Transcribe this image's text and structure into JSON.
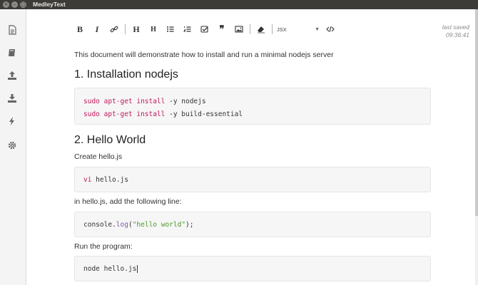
{
  "app": {
    "title": "MedleyText"
  },
  "window_controls": {
    "close": "×",
    "minimize": "–",
    "maximize": "□"
  },
  "toolbar": {
    "bold": "B",
    "italic": "I",
    "link_icon": "link-icon",
    "h1": "H",
    "h2": "H",
    "unordered_list_icon": "list-icon",
    "ordered_list_icon": "ordered-list-icon",
    "checklist_icon": "checklist-icon",
    "quote": "❞",
    "image_icon": "image-icon",
    "eraser_icon": "eraser-icon",
    "language_value": "JSX",
    "code_icon": "code-icon"
  },
  "save_status": {
    "label": "last saved",
    "time": "09:36:41"
  },
  "document": {
    "intro": "This document will demonstrate how to install and run a minimal nodejs server",
    "section1_title": "1. Installation nodejs",
    "code1": {
      "line1": {
        "cmd": "sudo apt-get install",
        "args": " -y nodejs"
      },
      "line2": {
        "cmd": "sudo apt-get install",
        "args": " -y build-essential"
      }
    },
    "section2_title": "2. Hello World",
    "create_text": "Create hello.js",
    "code2": {
      "cmd": "vi",
      "args": " hello.js"
    },
    "add_line_text": "in hello.js, add the following line:",
    "code3": {
      "obj": "console",
      "dot": ".",
      "fn": "log",
      "open": "(",
      "str": "\"hello world\"",
      "close": ");"
    },
    "run_text": "Run the program:",
    "code4": {
      "text": "node hello.js"
    }
  },
  "colors": {
    "titlebar": "#3c3b37",
    "keyword": "#c2185b",
    "function": "#7b5aa6",
    "string": "#4c9a2a"
  }
}
